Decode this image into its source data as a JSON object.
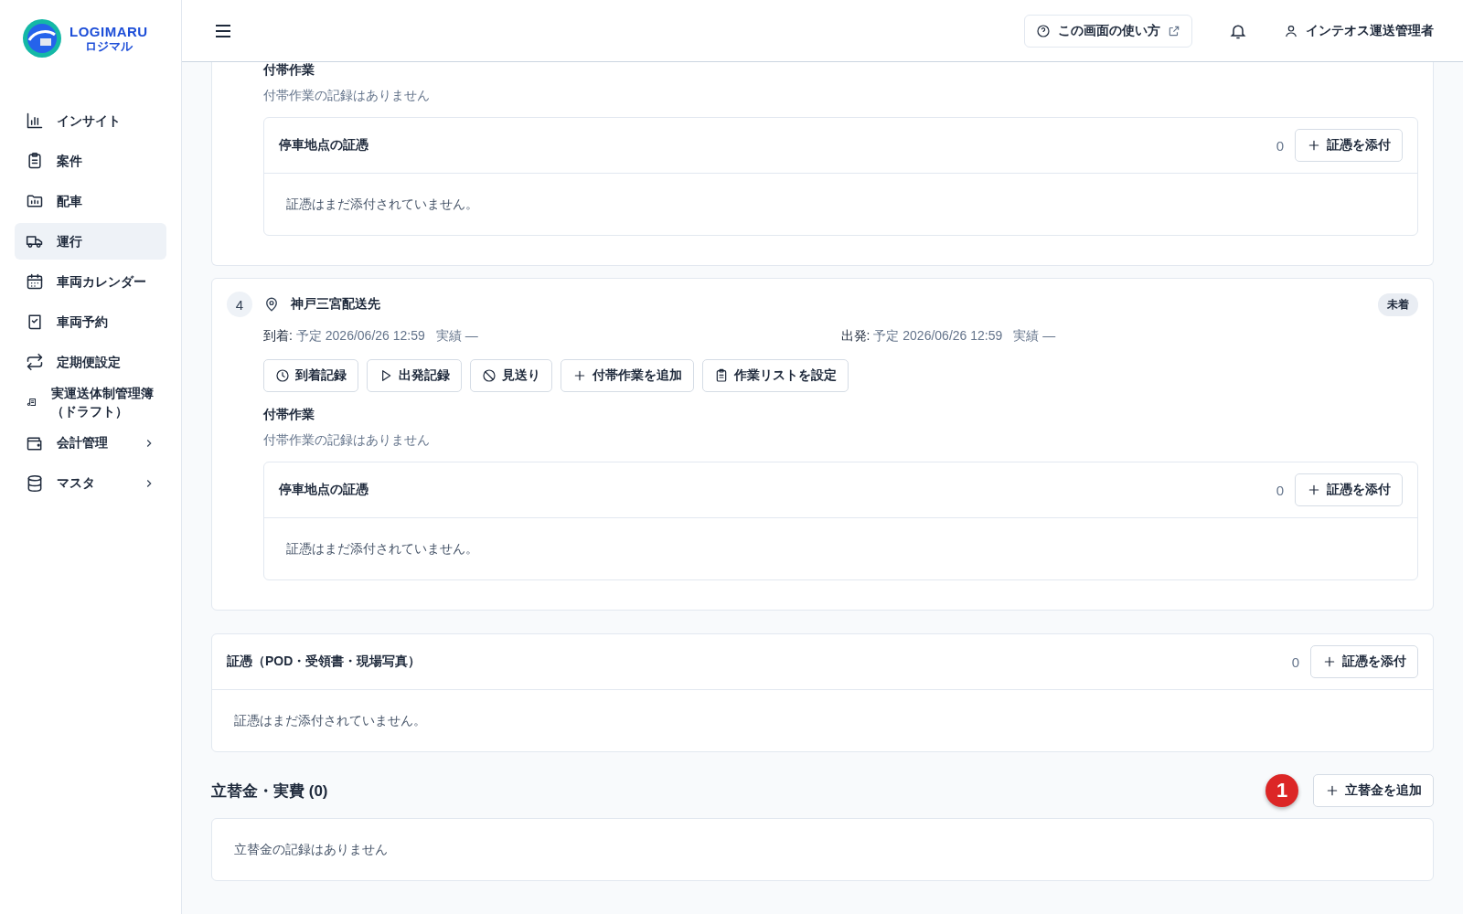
{
  "sidebar": {
    "logo": {
      "name": "LOGIMARU",
      "sub": "ロジマル"
    },
    "items": [
      {
        "label": "インサイト",
        "kind": "chart",
        "selected": false,
        "expandable": false
      },
      {
        "label": "案件",
        "kind": "clipboard",
        "selected": false,
        "expandable": false
      },
      {
        "label": "配車",
        "kind": "folder",
        "selected": false,
        "expandable": false
      },
      {
        "label": "運行",
        "kind": "truck",
        "selected": true,
        "expandable": false
      },
      {
        "label": "車両カレンダー",
        "kind": "calendar",
        "selected": false,
        "expandable": false
      },
      {
        "label": "車両予約",
        "kind": "book",
        "selected": false,
        "expandable": false
      },
      {
        "label": "定期便設定",
        "kind": "repeat",
        "selected": false,
        "expandable": false
      },
      {
        "label": "実運送体制管理簿（ドラフト）",
        "kind": "scroll",
        "selected": false,
        "expandable": false
      },
      {
        "label": "会計管理",
        "kind": "wallet",
        "selected": false,
        "expandable": true
      },
      {
        "label": "マスタ",
        "kind": "database",
        "selected": false,
        "expandable": true
      }
    ]
  },
  "header": {
    "help_button": "この画面の使い方",
    "user": "インテオス運送管理者"
  },
  "stops": [
    {
      "tasks_heading": "付帯作業",
      "tasks_empty": "付帯作業の記録はありません",
      "evidence": {
        "title": "停車地点の証憑",
        "count": "0",
        "button": "証憑を添付",
        "empty": "証憑はまだ添付されていません。"
      }
    },
    {
      "number": "4",
      "name": "神戸三宮配送先",
      "status": "未着",
      "arrival": {
        "label": "到着:",
        "planned": "予定 2026/06/26 12:59",
        "actual": "実績 —"
      },
      "departure": {
        "label": "出発:",
        "planned": "予定 2026/06/26 12:59",
        "actual": "実績 —"
      },
      "actions": [
        {
          "label": "到着記録",
          "kind": "clock"
        },
        {
          "label": "出発記録",
          "kind": "play"
        },
        {
          "label": "見送り",
          "kind": "ban"
        },
        {
          "label": "付帯作業を追加",
          "kind": "plus"
        },
        {
          "label": "作業リストを設定",
          "kind": "clipboard"
        }
      ],
      "tasks_heading": "付帯作業",
      "tasks_empty": "付帯作業の記録はありません",
      "evidence": {
        "title": "停車地点の証憑",
        "count": "0",
        "button": "証憑を添付",
        "empty": "証憑はまだ添付されていません。"
      }
    }
  ],
  "evidence": {
    "title": "証憑（POD・受領書・現場写真）",
    "count": "0",
    "button": "証憑を添付",
    "empty": "証憑はまだ添付されていません。"
  },
  "expenses": {
    "title": "立替金・実費 (0)",
    "callout": "1",
    "button": "立替金を追加",
    "empty": "立替金の記録はありません"
  }
}
